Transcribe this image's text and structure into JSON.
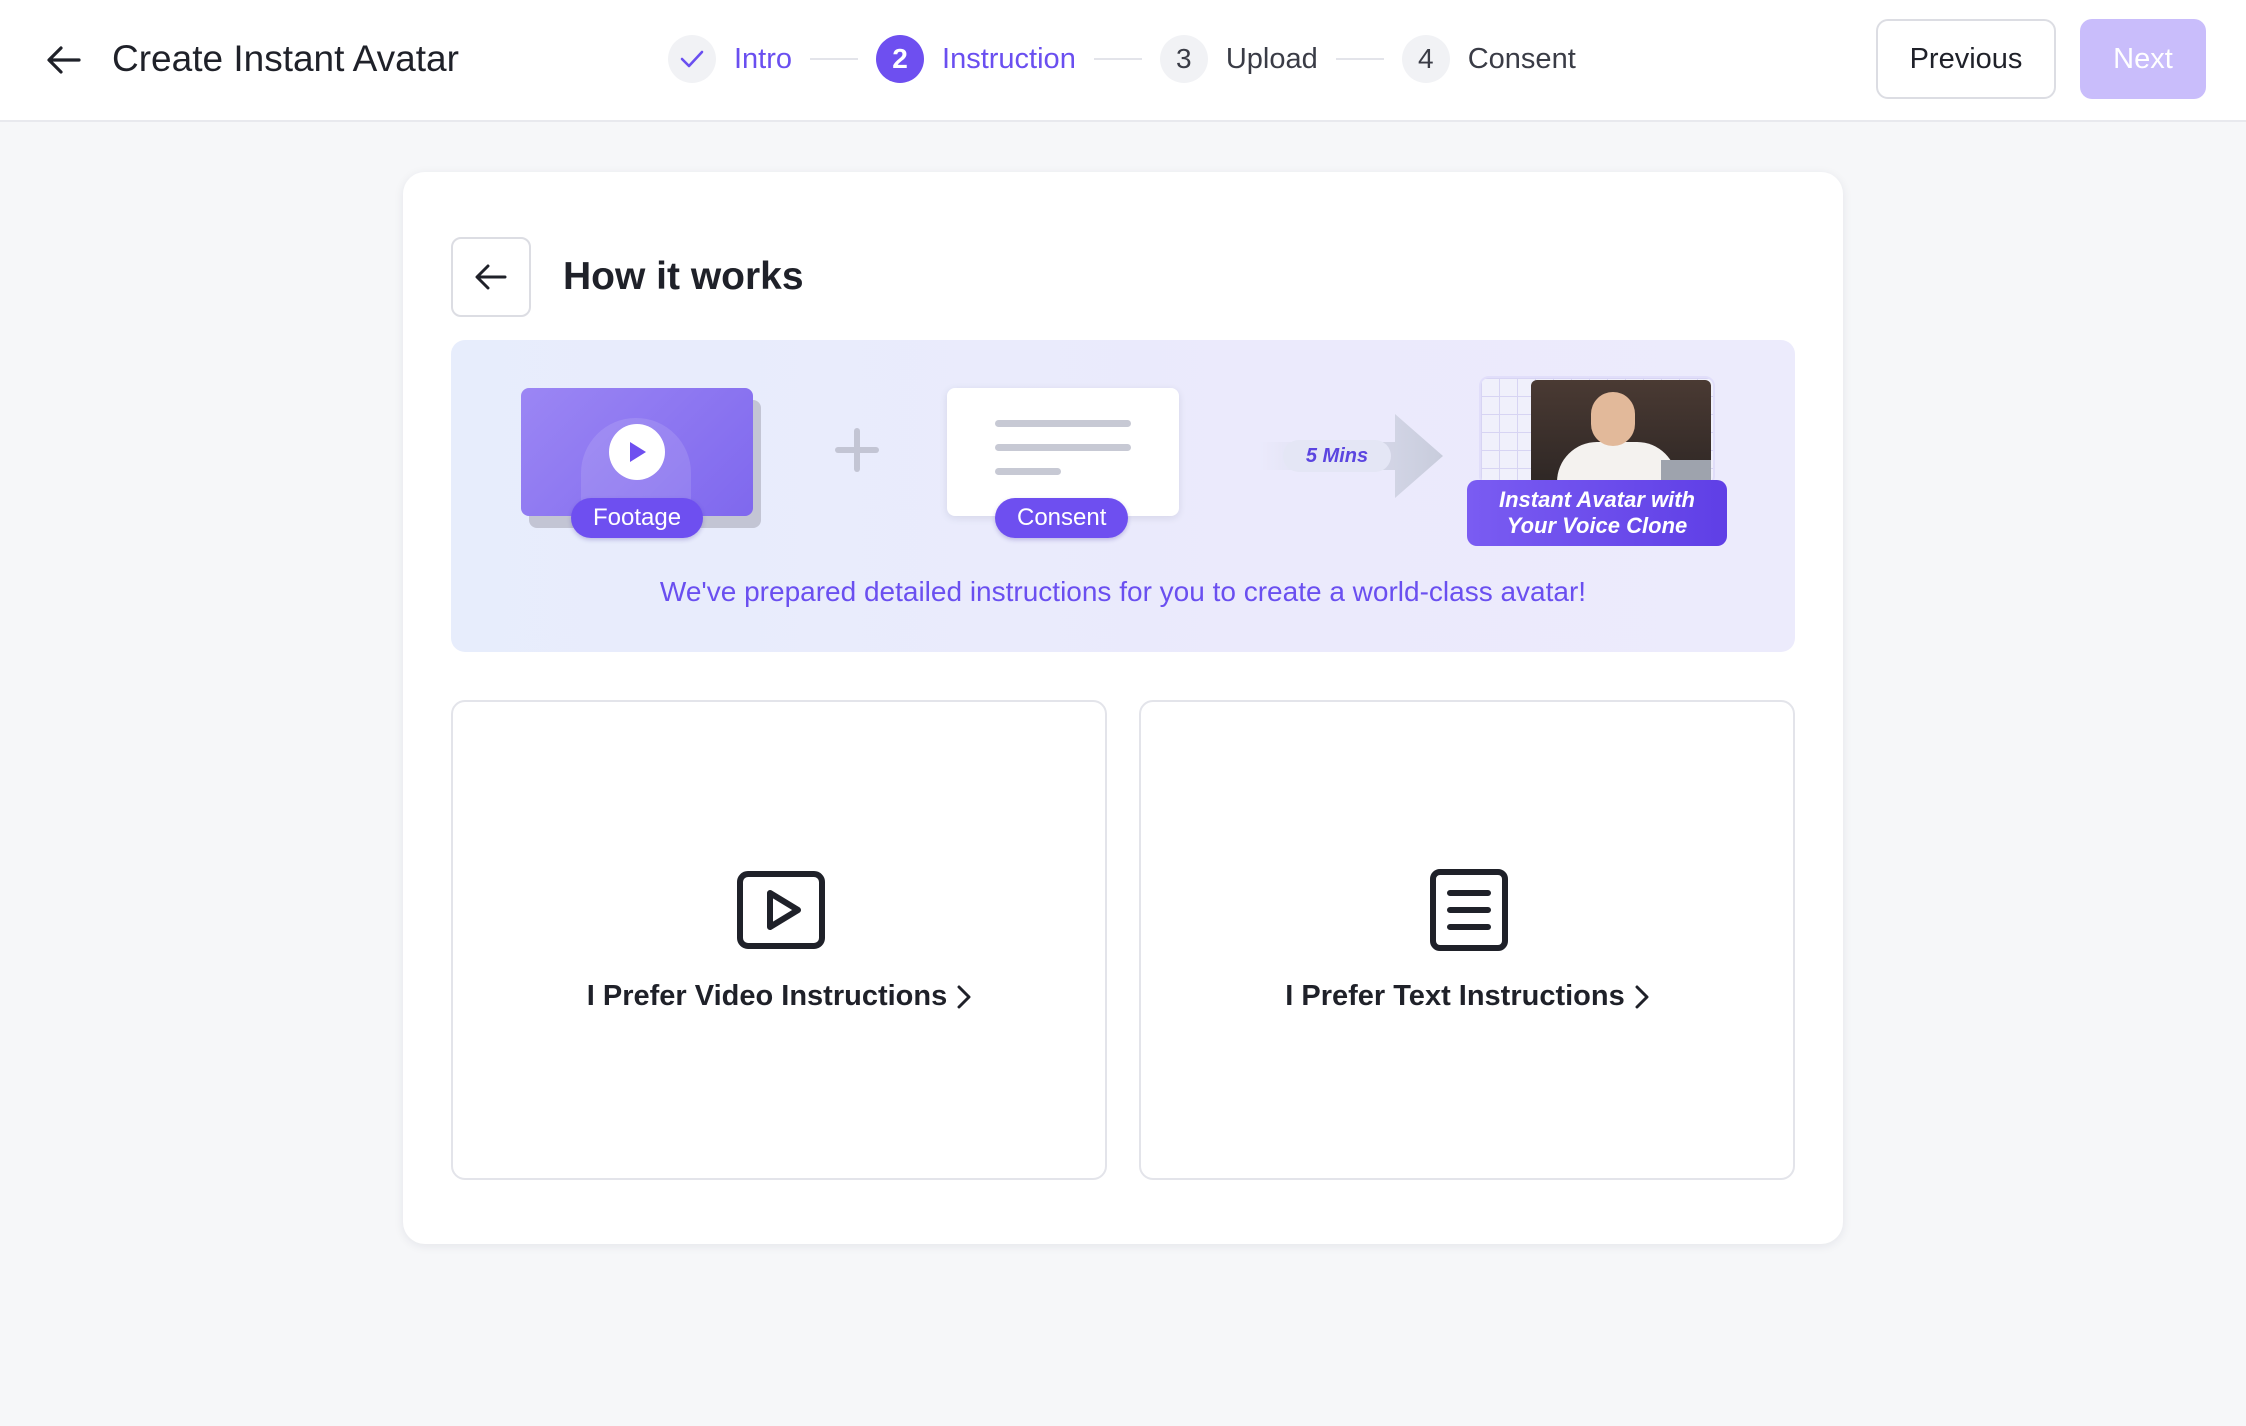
{
  "header": {
    "title": "Create Instant Avatar",
    "previous_label": "Previous",
    "next_label": "Next"
  },
  "steps": [
    {
      "number": "",
      "label": "Intro",
      "state": "completed"
    },
    {
      "number": "2",
      "label": "Instruction",
      "state": "active"
    },
    {
      "number": "3",
      "label": "Upload",
      "state": "pending"
    },
    {
      "number": "4",
      "label": "Consent",
      "state": "pending"
    }
  ],
  "card": {
    "title": "How it works",
    "banner": {
      "footage_label": "Footage",
      "consent_label": "Consent",
      "duration_label": "5 Mins",
      "result_line1": "Instant Avatar with",
      "result_line2": "Your Voice Clone",
      "caption": "We've prepared detailed instructions for you to create a world-class avatar!"
    },
    "options": [
      {
        "label": "I Prefer Video Instructions",
        "icon": "video-play-icon"
      },
      {
        "label": "I Prefer Text Instructions",
        "icon": "document-icon"
      }
    ]
  },
  "colors": {
    "accent": "#6e4ff0",
    "accent_disabled": "#c9bdfb",
    "text": "#1f2129",
    "page_bg": "#f6f7f9"
  }
}
